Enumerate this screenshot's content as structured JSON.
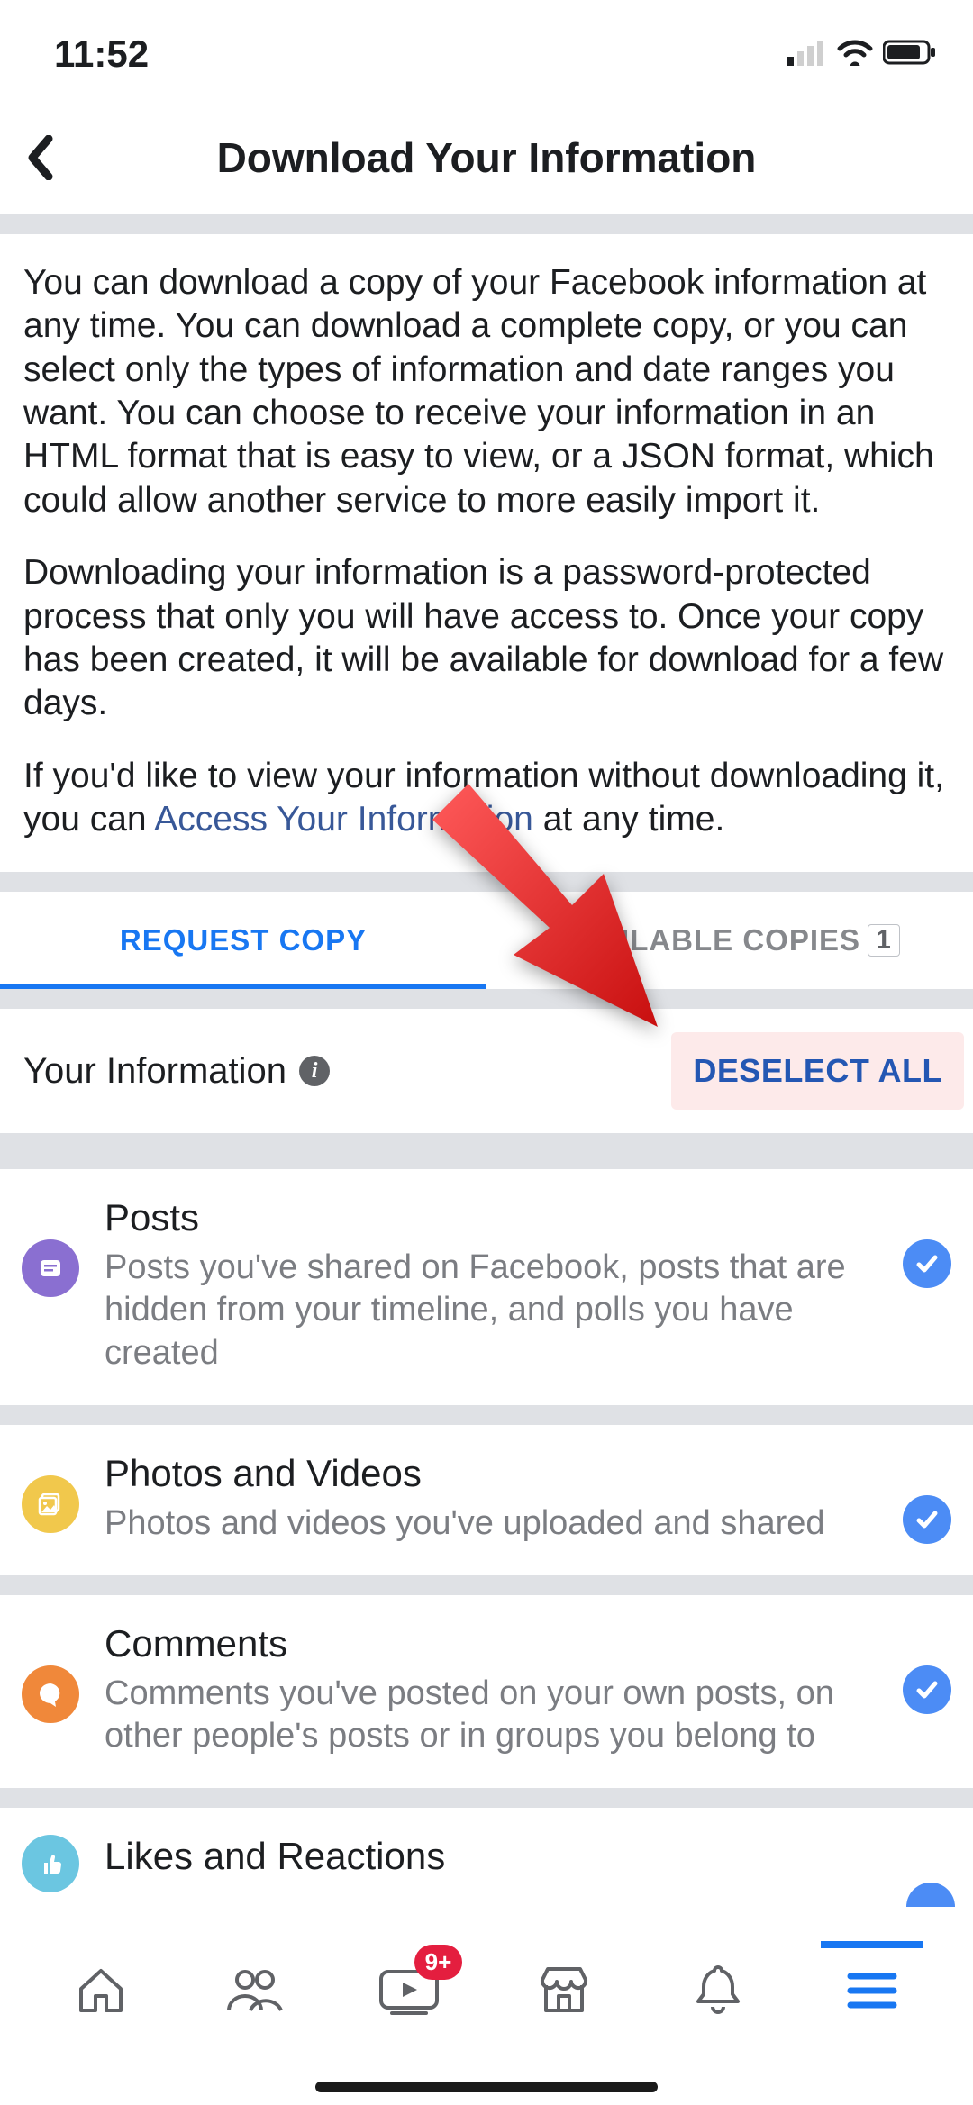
{
  "status": {
    "time": "11:52"
  },
  "header": {
    "title": "Download Your Information"
  },
  "description": {
    "p1": "You can download a copy of your Facebook information at any time. You can download a complete copy, or you can select only the types of information and date ranges you want. You can choose to receive your information in an HTML format that is easy to view, or a JSON format, which could allow another service to more easily import it.",
    "p2": "Downloading your information is a password-protected process that only you will have access to. Once your copy has been created, it will be available for download for a few days.",
    "p3_pre": "If you'd like to view your information without downloading it, you can ",
    "p3_link": "Access Your Information",
    "p3_post": " at any time."
  },
  "tabs": {
    "request": "REQUEST COPY",
    "available": "AVAILABLE COPIES",
    "available_count": "1"
  },
  "section": {
    "title": "Your Information",
    "deselect": "DESELECT ALL"
  },
  "items": [
    {
      "title": "Posts",
      "desc": "Posts you've shared on Facebook, posts that are hidden from your timeline, and polls you have created",
      "icon": "posts-icon",
      "color": "purple",
      "checked": true
    },
    {
      "title": "Photos and Videos",
      "desc": "Photos and videos you've uploaded and shared",
      "icon": "photos-icon",
      "color": "yellow",
      "checked": true
    },
    {
      "title": "Comments",
      "desc": "Comments you've posted on your own posts, on other people's posts or in groups you belong to",
      "icon": "comments-icon",
      "color": "orange",
      "checked": true
    },
    {
      "title": "Likes and Reactions",
      "desc": "",
      "icon": "likes-icon",
      "color": "blue",
      "checked": true
    }
  ],
  "tabbar": {
    "watch_badge": "9+"
  },
  "colors": {
    "accent": "#1877f2",
    "divider": "#dfe1e5",
    "muted": "#7b7d82"
  },
  "annotation": {
    "arrow_target": "deselect-all-button"
  }
}
